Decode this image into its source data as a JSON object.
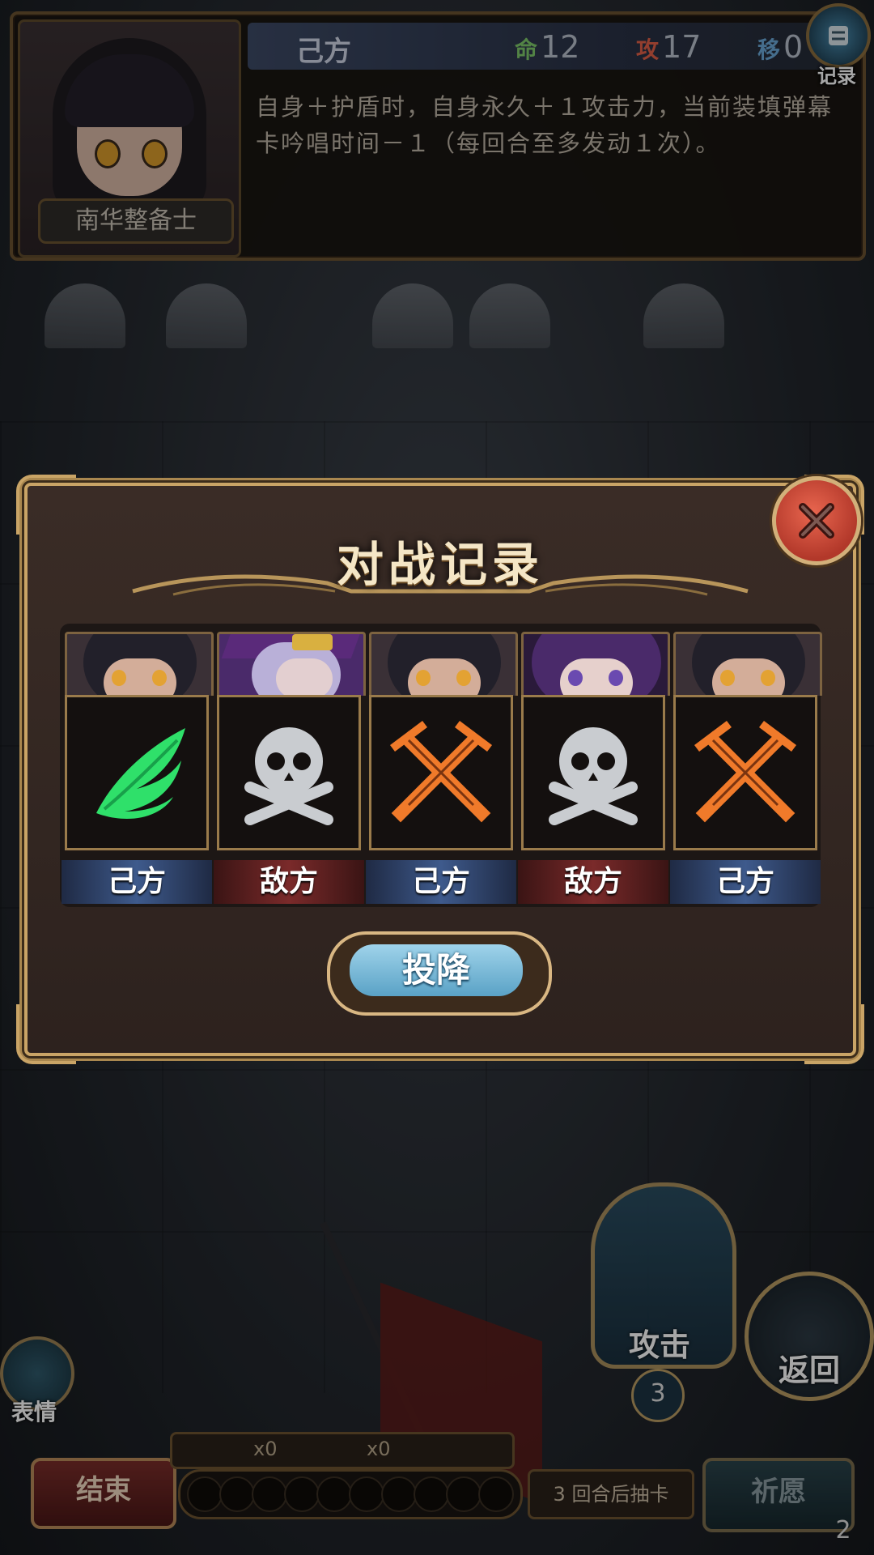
{
  "top_panel": {
    "unit_name": "南华整备士",
    "side": "己方",
    "stats": {
      "hp_label": "命",
      "hp_value": "12",
      "atk_label": "攻",
      "atk_value": "17",
      "mov_label": "移",
      "mov_value": "0"
    },
    "skill_text": "自身＋护盾时，自身永久＋１攻击力，当前装填弹幕卡吟唱时间－１（每回合至多发动１次）。",
    "log_button_label": "记录"
  },
  "modal": {
    "title": "对战记录",
    "records": [
      {
        "side_label": "己方",
        "side": "ally",
        "icon": "green-wing-icon",
        "avatar": "dark-hair-girl"
      },
      {
        "side_label": "敌方",
        "side": "enemy",
        "icon": "skull-crossbones-icon",
        "avatar": "purple-hair-girl-hat"
      },
      {
        "side_label": "己方",
        "side": "ally",
        "icon": "crossed-swords-icon",
        "avatar": "dark-hair-girl"
      },
      {
        "side_label": "敌方",
        "side": "enemy",
        "icon": "skull-crossbones-icon",
        "avatar": "purple-hair-girl"
      },
      {
        "side_label": "己方",
        "side": "ally",
        "icon": "crossed-swords-icon",
        "avatar": "dark-hair-girl"
      }
    ],
    "surrender_label": "投降"
  },
  "hud": {
    "attack_label": "攻击",
    "attack_count": "3",
    "return_label": "返回",
    "emote_label": "表情",
    "end_label": "结束",
    "res1": "x0",
    "res2": "x0",
    "draw_info": "3 回合后抽卡",
    "pray_label": "祈愿",
    "pray_count": "2"
  },
  "colors": {
    "ally_tag": "#3e5a8c",
    "enemy_tag": "#7a2a2a",
    "wing_green": "#34e06a",
    "swords_orange": "#f07a2a",
    "skull_grey": "#c9ccd0",
    "frame_gold": "#c9a466"
  }
}
